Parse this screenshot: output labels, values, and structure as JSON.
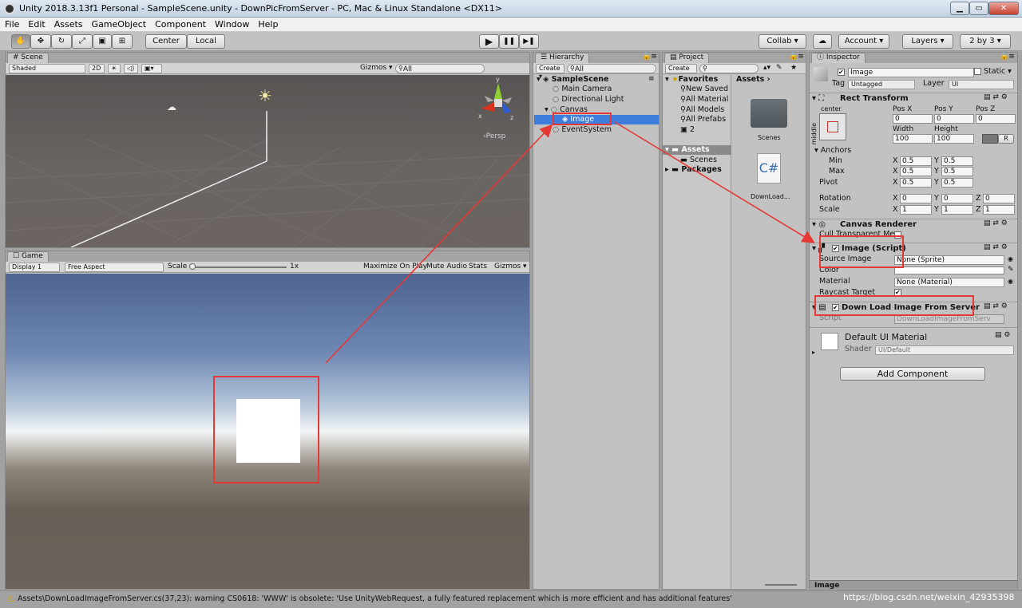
{
  "window": {
    "title": "Unity 2018.3.13f1 Personal - SampleScene.unity - DownPicFromServer - PC, Mac & Linux Standalone <DX11>",
    "controls": [
      "▁",
      "▭",
      "✕"
    ]
  },
  "menu": [
    "File",
    "Edit",
    "Assets",
    "GameObject",
    "Component",
    "Window",
    "Help"
  ],
  "toolbar": {
    "center": "Center",
    "local": "Local",
    "collab": "Collab ▾",
    "account": "Account ▾",
    "layers": "Layers ▾",
    "layout": "2 by 3 ▾",
    "play": "▶",
    "pause": "❚❚",
    "step": "▶❚"
  },
  "scene": {
    "tab": "Scene",
    "shading": "Shaded",
    "mode2d": "2D",
    "gizmos": "Gizmos ▾",
    "search": "All",
    "persp": "Persp",
    "gizmo_axes": {
      "y": "y",
      "x": "x",
      "z": "z"
    }
  },
  "game": {
    "tab": "Game",
    "display": "Display 1",
    "aspect": "Free Aspect",
    "scale": "Scale",
    "scale_value": "1x",
    "maximize": "Maximize On Play",
    "mute": "Mute Audio",
    "stats": "Stats",
    "gizmos": "Gizmos ▾"
  },
  "hierarchy": {
    "tab": "Hierarchy",
    "create": "Create ▾",
    "search": "All",
    "scene": "SampleScene",
    "items": [
      "Main Camera",
      "Directional Light",
      "Canvas",
      "Image",
      "EventSystem"
    ]
  },
  "project": {
    "tab": "Project",
    "create": "Create ▾",
    "favorites": "Favorites",
    "fav_items": [
      "New Saved",
      "All Material",
      "All Models",
      "All Prefabs",
      "2"
    ],
    "assets": "Assets",
    "asset_children": [
      "Scenes"
    ],
    "packages": "Packages",
    "breadcrumb": "Assets ›",
    "files": [
      {
        "name": "Scenes",
        "type": "folder"
      },
      {
        "name": "DownLoad...",
        "type": "C#"
      }
    ]
  },
  "inspector": {
    "tab": "Inspector",
    "object_name": "Image",
    "static": "Static ▾",
    "tag_label": "Tag",
    "tag": "Untagged",
    "layer_label": "Layer",
    "layer": "UI",
    "rect_transform": {
      "title": "Rect Transform",
      "anchor_h": "center",
      "anchor_v": "middle",
      "pos_labels": [
        "Pos X",
        "Pos Y",
        "Pos Z"
      ],
      "pos": [
        "0",
        "0",
        "0"
      ],
      "size_labels": [
        "Width",
        "Height"
      ],
      "size": [
        "100",
        "100"
      ],
      "anchors": "Anchors",
      "min": "Min",
      "max": "Max",
      "min_x": "0.5",
      "min_y": "0.5",
      "max_x": "0.5",
      "max_y": "0.5",
      "pivot": "Pivot",
      "pivot_x": "0.5",
      "pivot_y": "0.5",
      "rotation": "Rotation",
      "rot": [
        "0",
        "0",
        "0"
      ],
      "scale": "Scale",
      "scl": [
        "1",
        "1",
        "1"
      ],
      "r": "R",
      "axis": [
        "X",
        "Y",
        "Z"
      ]
    },
    "canvas_renderer": {
      "title": "Canvas Renderer",
      "cull": "Cull Transparent Me"
    },
    "image": {
      "title": "Image (Script)",
      "source_label": "Source Image",
      "source": "None (Sprite)",
      "color_label": "Color",
      "material_label": "Material",
      "material": "None (Material)",
      "raycast": "Raycast Target"
    },
    "download": {
      "title": "Down Load Image From Server",
      "script_label": "Script",
      "script": "DownLoadImageFromServ"
    },
    "material": {
      "name": "Default UI Material",
      "shader_label": "Shader",
      "shader": "UI/Default"
    },
    "add_component": "Add Component",
    "preview": "Image"
  },
  "status": {
    "message": "Assets\\DownLoadImageFromServer.cs(37,23): warning CS0618: 'WWW' is obsolete: 'Use UnityWebRequest, a fully featured replacement which is more efficient and has additional features'",
    "watermark": "https://blog.csdn.net/weixin_42935398"
  },
  "colors": {
    "highlight_red": "#e53935",
    "selection_blue": "#3d7ddc",
    "unity_gray": "#c2c2c2"
  }
}
